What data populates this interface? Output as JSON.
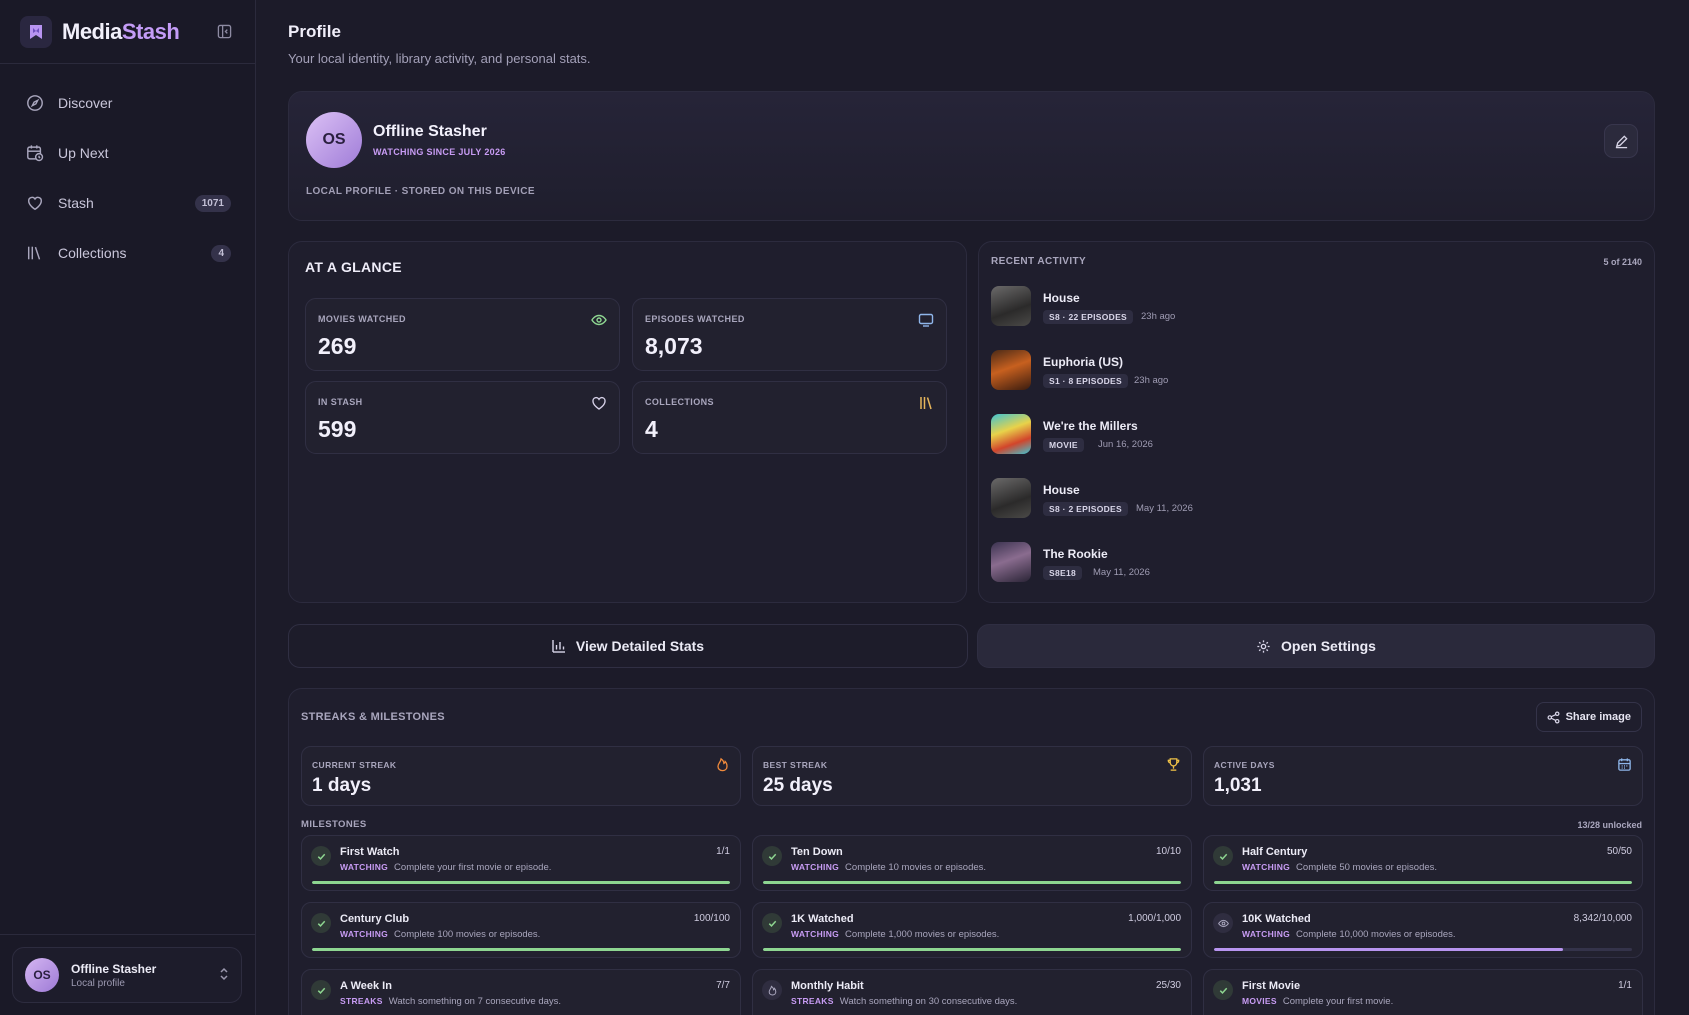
{
  "brand": {
    "name_a": "Media",
    "name_b": "Stash"
  },
  "nav": [
    {
      "label": "Discover",
      "icon": "compass-icon",
      "badge": ""
    },
    {
      "label": "Up Next",
      "icon": "calendar-clock-icon",
      "badge": ""
    },
    {
      "label": "Stash",
      "icon": "heart-icon",
      "badge": "1071"
    },
    {
      "label": "Collections",
      "icon": "library-icon",
      "badge": "4"
    }
  ],
  "user": {
    "initials": "OS",
    "name": "Offline Stasher",
    "sub": "Local profile"
  },
  "page": {
    "title": "Profile",
    "subtitle": "Your local identity, library activity, and personal stats."
  },
  "profile": {
    "initials": "OS",
    "name": "Offline Stasher",
    "since": "WATCHING SINCE JULY 2026",
    "local": "LOCAL PROFILE · STORED ON THIS DEVICE"
  },
  "glance": {
    "title": "AT A GLANCE",
    "stats": [
      {
        "label": "MOVIES WATCHED",
        "value": "269",
        "icon": "eye-icon"
      },
      {
        "label": "EPISODES WATCHED",
        "value": "8,073",
        "icon": "tv-icon"
      },
      {
        "label": "IN STASH",
        "value": "599",
        "icon": "heart-icon"
      },
      {
        "label": "COLLECTIONS",
        "value": "4",
        "icon": "library-icon"
      }
    ]
  },
  "recent": {
    "title": "RECENT ACTIVITY",
    "count": "5 of 2140",
    "items": [
      {
        "title": "House",
        "tag": "S8 · 22 EPISODES",
        "when": "23h ago"
      },
      {
        "title": "Euphoria (US)",
        "tag": "S1 · 8 EPISODES",
        "when": "23h ago"
      },
      {
        "title": "We're the Millers",
        "tag": "MOVIE",
        "when": "Jun 16, 2026"
      },
      {
        "title": "House",
        "tag": "S8 · 2 EPISODES",
        "when": "May 11, 2026"
      },
      {
        "title": "The Rookie",
        "tag": "S8E18",
        "when": "May 11, 2026"
      }
    ]
  },
  "buttons": {
    "stats": "View Detailed Stats",
    "settings": "Open Settings"
  },
  "streaks": {
    "title": "STREAKS & MILESTONES",
    "share": "Share image",
    "boxes": [
      {
        "label": "CURRENT STREAK",
        "value": "1 days",
        "icon": "flame-icon"
      },
      {
        "label": "BEST STREAK",
        "value": "25 days",
        "icon": "trophy-icon"
      },
      {
        "label": "ACTIVE DAYS",
        "value": "1,031",
        "icon": "calendar-icon"
      }
    ],
    "milestones_title": "MILESTONES",
    "unlocked": "13/28 unlocked",
    "milestones": [
      {
        "name": "First Watch",
        "progress": "1/1",
        "category": "WATCHING",
        "desc": "Complete your first movie or episode.",
        "fraction": 1,
        "done": true
      },
      {
        "name": "Ten Down",
        "progress": "10/10",
        "category": "WATCHING",
        "desc": "Complete 10 movies or episodes.",
        "fraction": 1,
        "done": true
      },
      {
        "name": "Half Century",
        "progress": "50/50",
        "category": "WATCHING",
        "desc": "Complete 50 movies or episodes.",
        "fraction": 1,
        "done": true
      },
      {
        "name": "Century Club",
        "progress": "100/100",
        "category": "WATCHING",
        "desc": "Complete 100 movies or episodes.",
        "fraction": 1,
        "done": true
      },
      {
        "name": "1K Watched",
        "progress": "1,000/1,000",
        "category": "WATCHING",
        "desc": "Complete 1,000 movies or episodes.",
        "fraction": 1,
        "done": true
      },
      {
        "name": "10K Watched",
        "progress": "8,342/10,000",
        "category": "WATCHING",
        "desc": "Complete 10,000 movies or episodes.",
        "fraction": 0.8342,
        "done": false
      },
      {
        "name": "A Week In",
        "progress": "7/7",
        "category": "STREAKS",
        "desc": "Watch something on 7 consecutive days.",
        "fraction": 1,
        "done": true
      },
      {
        "name": "Monthly Habit",
        "progress": "25/30",
        "category": "STREAKS",
        "desc": "Watch something on 30 consecutive days.",
        "fraction": 0.8333,
        "done": false
      },
      {
        "name": "First Movie",
        "progress": "1/1",
        "category": "MOVIES",
        "desc": "Complete your first movie.",
        "fraction": 1,
        "done": true
      }
    ]
  },
  "colors": {
    "accent": "#c49cf7",
    "success": "#8ed691",
    "progress": "#b895f0"
  }
}
